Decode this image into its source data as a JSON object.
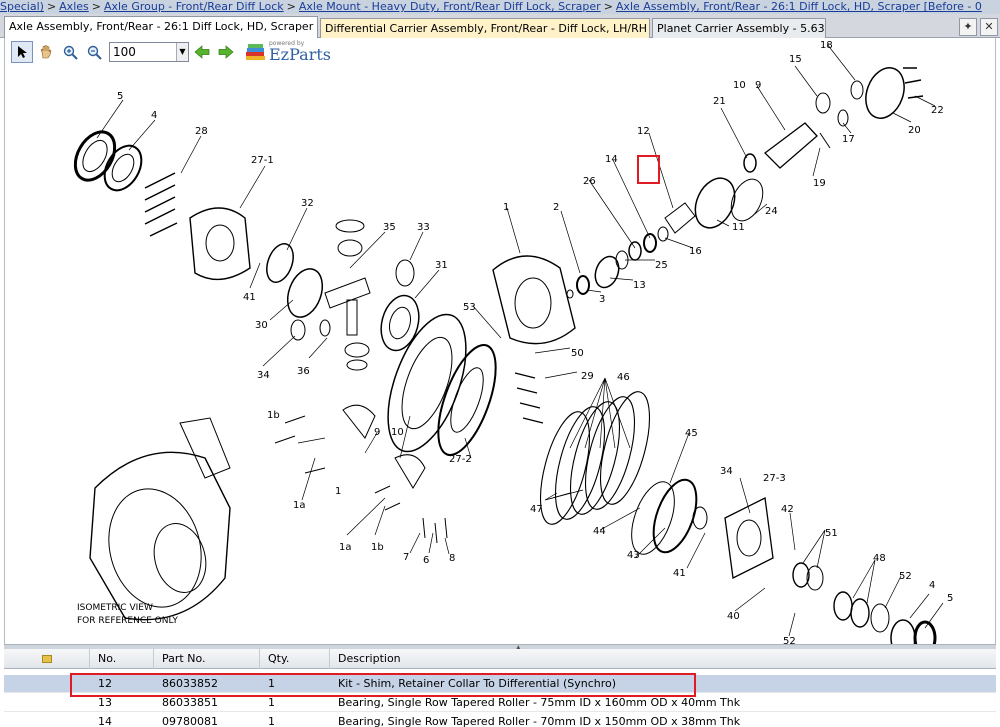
{
  "breadcrumb": {
    "lead": "Special)",
    "items": [
      "Axles",
      "Axle Group - Front/Rear Diff Lock",
      "Axle Mount - Heavy Duty, Front/Rear Diff Lock, Scraper",
      "Axle Assembly, Front/Rear - 26:1 Diff Lock, HD, Scraper [Before - 0"
    ],
    "separator": ">"
  },
  "tabs": [
    {
      "label": "Axle Assembly, Front/Rear - 26:1 Diff Lock, HD, Scraper"
    },
    {
      "label": "Differential Carrier Assembly, Front/Rear - Diff Lock, LH/RH"
    },
    {
      "label": "Planet Carrier Assembly - 5.63"
    }
  ],
  "toolbar": {
    "zoom_value": "100",
    "brand_powered": "powered by",
    "brand_name": "EzParts"
  },
  "diagram": {
    "note_line1": "ISOMETRIC VIEW",
    "note_line2": "FOR REFERENCE ONLY",
    "callouts": [
      "5",
      "4",
      "28",
      "27-1",
      "32",
      "35",
      "33",
      "31",
      "41",
      "30",
      "34",
      "36",
      "1",
      "2",
      "3",
      "13",
      "25",
      "16",
      "11",
      "26",
      "14",
      "12",
      "24",
      "21",
      "10",
      "9",
      "15",
      "18",
      "17",
      "20",
      "22",
      "19",
      "53",
      "50",
      "29",
      "46",
      "27-2",
      "1b",
      "9",
      "10",
      "1a",
      "1",
      "45",
      "34",
      "27-3",
      "42",
      "51",
      "48",
      "52",
      "4",
      "5",
      "47",
      "44",
      "43",
      "41",
      "40",
      "52",
      "7",
      "6",
      "8",
      "1a",
      "1b"
    ]
  },
  "grid": {
    "headers": {
      "no": "No.",
      "part_no": "Part No.",
      "qty": "Qty.",
      "description": "Description"
    },
    "rows": [
      {
        "no": "12",
        "part_no": "86033852",
        "qty": "1",
        "description": "Kit - Shim, Retainer Collar To Differential (Synchro)"
      },
      {
        "no": "13",
        "part_no": "86033851",
        "qty": "1",
        "description": "Bearing, Single Row Tapered Roller - 75mm ID x 160mm OD x 40mm Thk"
      },
      {
        "no": "14",
        "part_no": "09780081",
        "qty": "1",
        "description": "Bearing, Single Row Tapered Roller - 70mm ID x 150mm OD x 38mm Thk"
      }
    ]
  },
  "colors": {
    "highlight": "#e01b24",
    "selected_row": "#c6d3e6",
    "link": "#1a3c99"
  }
}
